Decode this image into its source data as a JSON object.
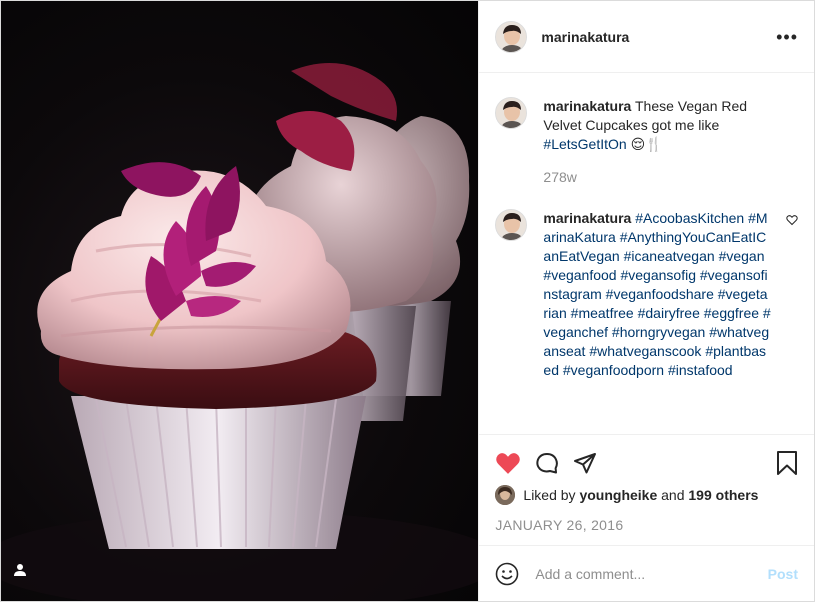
{
  "header": {
    "username": "marinakatura",
    "more_label": "•••"
  },
  "caption": {
    "username": "marinakatura",
    "text": " These Vegan Red Velvet Cupcakes got me like ",
    "hashtag": "#LetsGetItOn",
    "emoji": "😌🍴",
    "time": "278w"
  },
  "comment": {
    "username": "marinakatura",
    "hashtags": [
      "#AcoobasKitchen",
      "#MarinaKatura",
      "#AnythingYouCanEatICanEatVegan",
      "#icaneatvegan",
      "#vegan",
      "#veganfood",
      "#vegansofig",
      "#vegansofinstagram",
      "#veganfoodshare",
      "#vegetarian",
      "#meatfree",
      "#dairyfree",
      "#eggfree",
      "#veganchef",
      "#horngryvegan",
      "#whatveganseat",
      "#whatveganscook",
      "#plantbased",
      "#veganfoodporn",
      "#instafood"
    ]
  },
  "likes": {
    "prefix": "Liked by ",
    "user": "youngheike",
    "middle": " and ",
    "count": "199 others"
  },
  "date": "JANUARY 26, 2016",
  "add_comment": {
    "placeholder": "Add a comment...",
    "post_label": "Post"
  },
  "colors": {
    "like_red": "#ed4956",
    "hashtag_blue": "#00376b",
    "post_blue": "#b2dffc"
  }
}
